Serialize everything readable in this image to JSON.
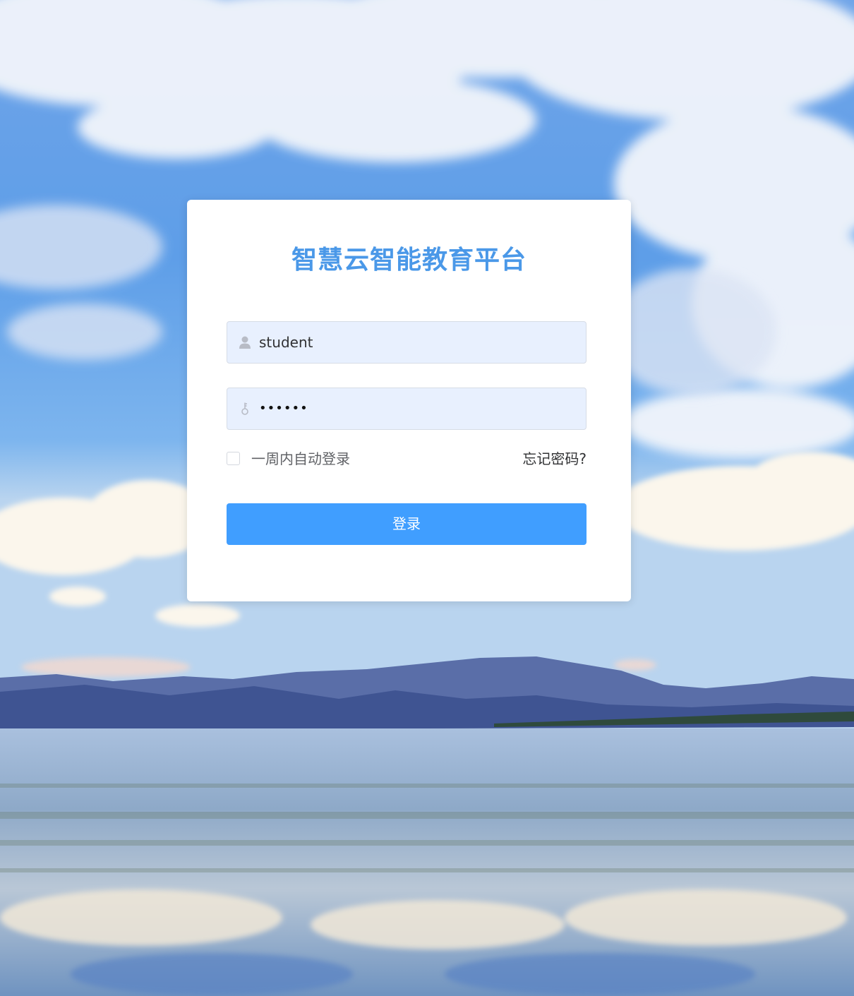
{
  "platform": {
    "title": "智慧云智能教育平台"
  },
  "login": {
    "username_value": "student",
    "password_value": "••••••",
    "remember_label": "一周内自动登录",
    "remember_checked": false,
    "forgot_label": "忘记密码?",
    "submit_label": "登录"
  },
  "icons": {
    "username": "user-icon",
    "password": "key-icon"
  },
  "colors": {
    "title": "#4a98e8",
    "button": "#409eff",
    "field_bg": "#e8f0fe"
  }
}
